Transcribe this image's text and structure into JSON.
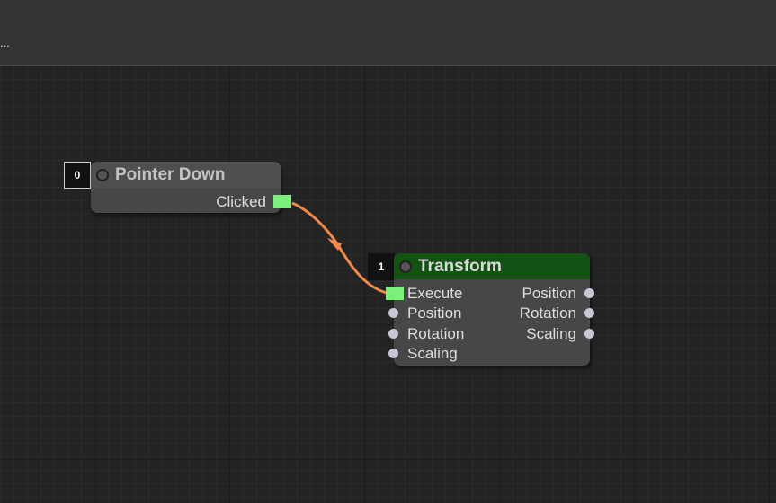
{
  "toolbar": {
    "overflow_text": "..."
  },
  "colors": {
    "canvas_bg": "#232323",
    "node_body": "#474747",
    "transform_header": "#145214",
    "pointer_header": "#4f4f4f",
    "execute_slot": "#7af07a",
    "link": "#f08a4b",
    "data_slot": "#c7c7d6"
  },
  "nodes": {
    "pointer_down": {
      "index": "0",
      "title": "Pointer Down",
      "outputs": [
        "Clicked"
      ]
    },
    "transform": {
      "index": "1",
      "title": "Transform",
      "inputs": [
        "Execute",
        "Position",
        "Rotation",
        "Scaling"
      ],
      "outputs": [
        "Position",
        "Rotation",
        "Scaling"
      ]
    }
  },
  "links": [
    {
      "from": "Pointer Down.Clicked",
      "to": "Transform.Execute"
    }
  ]
}
